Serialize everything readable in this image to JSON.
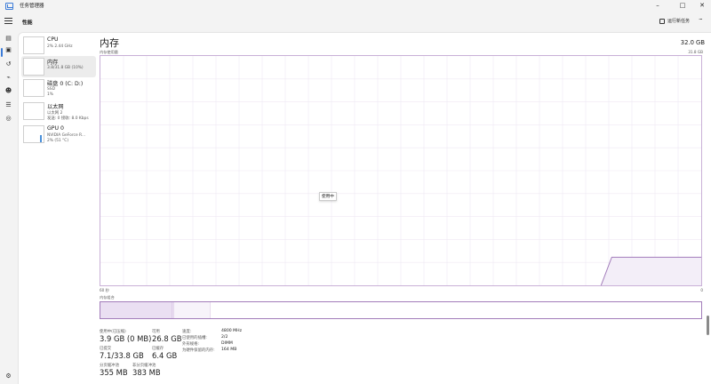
{
  "window": {
    "title": "任务管理器",
    "min": "–",
    "max": "□",
    "close": "✕"
  },
  "toolbar": {
    "page_title": "性能",
    "run_task": "运行新任务",
    "more": "···"
  },
  "resources": [
    {
      "name": "CPU",
      "sub1": "2% 2.44 GHz",
      "sub2": ""
    },
    {
      "name": "内存",
      "sub1": "3.8/31.8 GB (10%)",
      "sub2": ""
    },
    {
      "name": "磁盘 0 (C: D:)",
      "sub1": "SSD",
      "sub2": "1%"
    },
    {
      "name": "以太网",
      "sub1": "以太网 2",
      "sub2": "发送: 0 接收: 8.0 Kbps"
    },
    {
      "name": "GPU 0",
      "sub1": "NVIDIA GeForce R...",
      "sub2": "2% (51 °C)"
    }
  ],
  "detail": {
    "title": "内存",
    "total": "32.0 GB",
    "usage_label": "内存使用量",
    "usage_max": "31.8 GB",
    "time_left": "60 秒",
    "time_right": "0",
    "tooltip": "使用中",
    "composition_label": "内存组合",
    "chart_data": {
      "type": "area",
      "xlabel": "60 秒",
      "ylim": [
        0,
        31.8
      ],
      "x_points": [
        0,
        50,
        51,
        52,
        60
      ],
      "y_points": [
        3.9,
        3.9,
        3.9,
        3.9,
        3.9
      ],
      "fill_color": "#f3eef8",
      "line_color": "#a27cba",
      "composition": [
        {
          "name": "使用中",
          "value_gb": 3.9,
          "color": "#eadff2"
        },
        {
          "name": "已修改",
          "value_gb": 0.1,
          "color": "#eadff2"
        },
        {
          "name": "备用",
          "value_gb": 2.0,
          "color": "#f7f3fa"
        },
        {
          "name": "可用",
          "value_gb": 26.8,
          "color": "#ffffff"
        }
      ]
    },
    "stats": {
      "in_use_label": "使用中(已压缩)",
      "in_use_value": "3.9 GB (0 MB)",
      "available_label": "可用",
      "available_value": "26.8 GB",
      "committed_label": "已提交",
      "committed_value": "7.1/33.8 GB",
      "cached_label": "已缓存",
      "cached_value": "6.4 GB",
      "paged_label": "分页缓冲池",
      "paged_value": "355 MB",
      "nonpaged_label": "非分页缓冲池",
      "nonpaged_value": "383 MB"
    },
    "props": [
      {
        "k": "速度:",
        "v": "4800 MHz"
      },
      {
        "k": "已使用的插槽:",
        "v": "2/2"
      },
      {
        "k": "外形规格:",
        "v": "DIMM"
      },
      {
        "k": "为硬件保留的内存:",
        "v": "164 MB"
      }
    ]
  },
  "colors": {
    "accent": "#3b7bd8",
    "memory": "#a27cba"
  }
}
